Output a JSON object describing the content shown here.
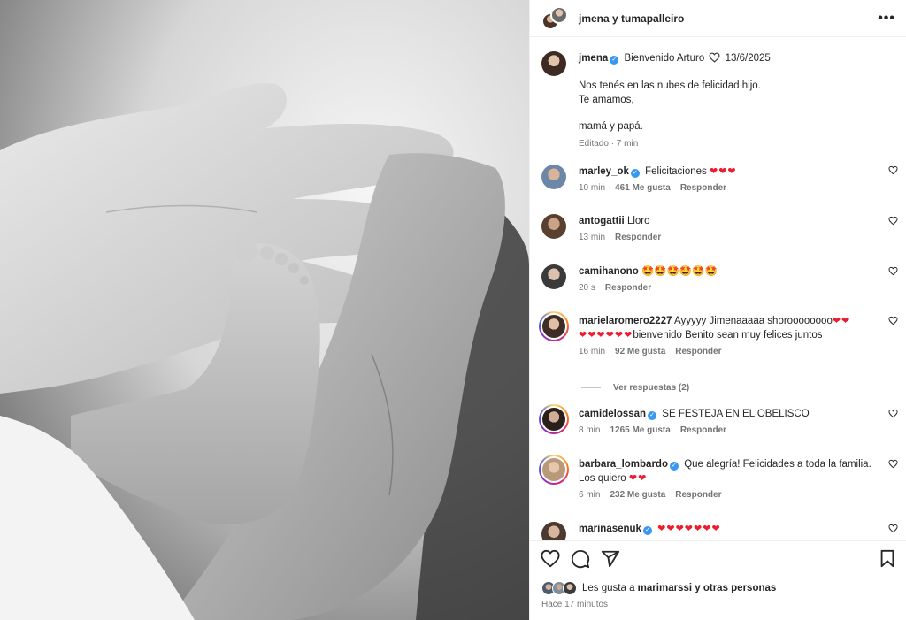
{
  "header": {
    "title": "jmena y tumapalleiro",
    "more_label": "•••"
  },
  "caption": {
    "username": "jmena",
    "title_text": "Bienvenido Arturo",
    "date": "13/6/2025",
    "lines": [
      "Nos tenés en las nubes de felicidad hijo.",
      "Te amamos,",
      "mamá y papá."
    ],
    "edited": "Editado · 7 min"
  },
  "comments": [
    {
      "username": "marley_ok",
      "verified": true,
      "text": "Felicitaciones",
      "emoji": "❤❤❤",
      "time": "10 min",
      "likes": "461 Me gusta",
      "reply": "Responder"
    },
    {
      "username": "antogattii",
      "verified": false,
      "text": "Lloro",
      "emoji": "",
      "time": "13 min",
      "likes": "",
      "reply": "Responder"
    },
    {
      "username": "camihanono",
      "verified": false,
      "text": "",
      "emoji": "🤩🤩🤩🤩🤩🤩",
      "time": "20 s",
      "likes": "",
      "reply": "Responder"
    },
    {
      "username": "marielaromero2227",
      "verified": false,
      "text": "Ayyyyy Jimenaaaaa shoroooooooo",
      "emoji": "❤❤",
      "text2_emoji": "❤❤❤❤❤❤",
      "text2": "bienvenido Benito sean muy felices juntos",
      "time": "16 min",
      "likes": "92 Me gusta",
      "reply": "Responder"
    },
    {
      "username": "camidelossan",
      "verified": true,
      "text": "SE FESTEJA EN EL OBELISCO",
      "emoji": "",
      "time": "8 min",
      "likes": "1265 Me gusta",
      "reply": "Responder"
    },
    {
      "username": "barbara_lombardo",
      "verified": true,
      "text": "Que alegría! Felicidades a toda la familia.",
      "text2": "Los quiero",
      "text2_emoji": "❤❤",
      "time": "6 min",
      "likes": "232 Me gusta",
      "reply": "Responder"
    },
    {
      "username": "marinasenuk",
      "verified": true,
      "text": "",
      "emoji": "❤❤❤❤❤❤❤"
    }
  ],
  "replies_toggle": "Ver respuestas (2)",
  "likes_line": {
    "prefix": "Les gusta a",
    "user": "marimarssi",
    "suffix": "y otras personas"
  },
  "posted": "Hace 17 minutos",
  "colors": {
    "verified": "#3897f0",
    "heart": "#ed1c2e",
    "muted": "#737373"
  },
  "icons": {
    "like": "heart-icon",
    "comment": "comment-icon",
    "share": "paper-plane-icon",
    "save": "bookmark-icon"
  }
}
